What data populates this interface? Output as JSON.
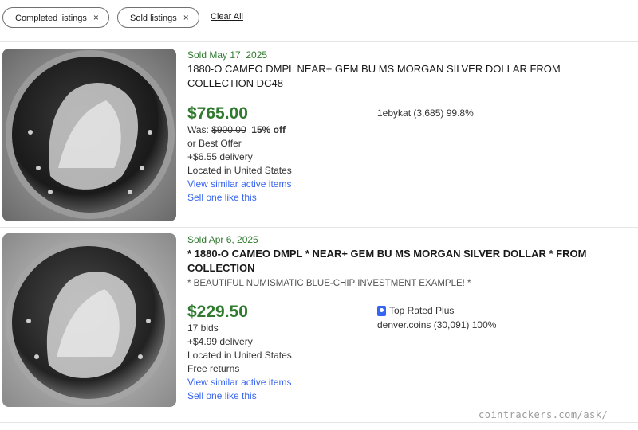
{
  "filters": {
    "chips": [
      {
        "label": "Completed listings",
        "remove": "×"
      },
      {
        "label": "Sold listings",
        "remove": "×"
      }
    ],
    "clear_all": "Clear All"
  },
  "listings": [
    {
      "sold_date": "Sold May 17, 2025",
      "title": "1880-O CAMEO DMPL NEAR+ GEM BU MS MORGAN SILVER DOLLAR FROM COLLECTION DC48",
      "price": "$765.00",
      "was_label": "Was:",
      "was_price": "$900.00",
      "discount": "15% off",
      "offer": "or Best Offer",
      "delivery": "+$6.55 delivery",
      "location": "Located in United States",
      "view_similar": "View similar active items",
      "sell_one": "Sell one like this",
      "seller": "1ebykat (3,685) 99.8%"
    },
    {
      "sold_date": "Sold Apr 6, 2025",
      "title": "* 1880-O CAMEO DMPL * NEAR+ GEM BU MS MORGAN SILVER DOLLAR * FROM COLLECTION",
      "subtitle": "* BEAUTIFUL NUMISMATIC BLUE-CHIP INVESTMENT EXAMPLE! *",
      "price": "$229.50",
      "bids": "17 bids",
      "delivery": "+$4.99 delivery",
      "location": "Located in United States",
      "returns": "Free returns",
      "view_similar": "View similar active items",
      "sell_one": "Sell one like this",
      "badge": "Top Rated Plus",
      "seller": "denver.coins (30,091) 100%"
    }
  ],
  "watermark": "cointrackers.com/ask/",
  "colors": {
    "sold_green": "#2f7a2f",
    "link_blue": "#3665f3",
    "text": "#191919"
  },
  "icons": [
    "close-icon",
    "top-rated-badge-icon"
  ]
}
